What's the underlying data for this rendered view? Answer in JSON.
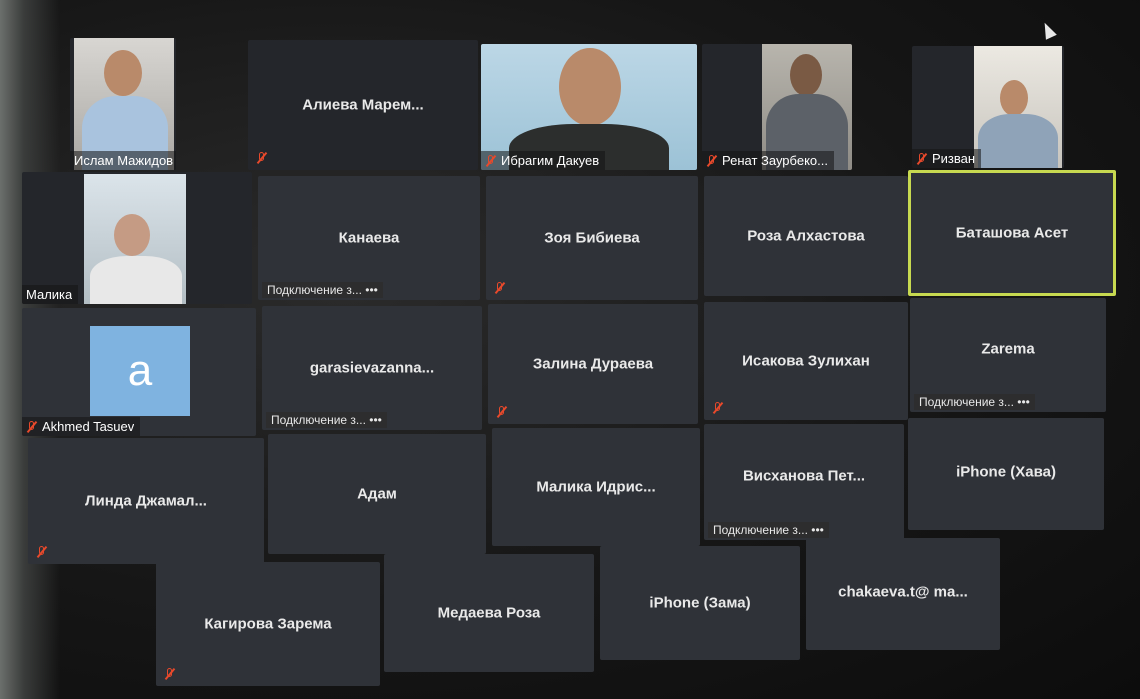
{
  "participants": [
    {
      "name": "Ислам Мажидов",
      "type": "video",
      "muted": false
    },
    {
      "name": "Алиева  Марем...",
      "type": "name",
      "muted": true
    },
    {
      "name": "Ибрагим Дакуев",
      "type": "video",
      "muted": true
    },
    {
      "name": "Ренат Заурбеко...",
      "type": "video",
      "muted": true
    },
    {
      "name": "Ризван",
      "type": "video",
      "muted": true
    },
    {
      "name": "Малика",
      "type": "video",
      "muted": false
    },
    {
      "name": "Канаева",
      "type": "name",
      "status": "Подключение з...  •••"
    },
    {
      "name": "Зоя Бибиева",
      "type": "name",
      "muted": true
    },
    {
      "name": "Роза Алхастова",
      "type": "name",
      "muted": false
    },
    {
      "name": "Баташова Асет",
      "type": "name",
      "active_speaker": true
    },
    {
      "name": "Akhmed Tasuev",
      "type": "avatar",
      "avatar_letter": "a",
      "muted": true
    },
    {
      "name": "garasievazanna...",
      "type": "name",
      "status": "Подключение з...  •••"
    },
    {
      "name": "Залина Дураева",
      "type": "name",
      "muted": true
    },
    {
      "name": "Исакова Зулихан",
      "type": "name",
      "muted": true
    },
    {
      "name": "Zarema",
      "type": "name",
      "status": "Подключение з...  •••"
    },
    {
      "name": "Линда  Джамал...",
      "type": "name",
      "muted": true
    },
    {
      "name": "Адам",
      "type": "name"
    },
    {
      "name": "Малика  Идрис...",
      "type": "name"
    },
    {
      "name": "Висханова  Пет...",
      "type": "name",
      "status": "Подключение з...  •••"
    },
    {
      "name": "iPhone (Хава)",
      "type": "name"
    },
    {
      "name": "Кагирова Зарема",
      "type": "name",
      "muted": true
    },
    {
      "name": "Медаева Роза",
      "type": "name"
    },
    {
      "name": "iPhone (Зама)",
      "type": "name"
    },
    {
      "name": "chakaeva.t@  ma...",
      "type": "name"
    }
  ],
  "colors": {
    "highlight": "#c7d950",
    "mute": "#e8492b",
    "tile": "#2f3238"
  },
  "icons": {
    "mute": "mic-off-icon",
    "cursor": "mouse-cursor-icon"
  }
}
